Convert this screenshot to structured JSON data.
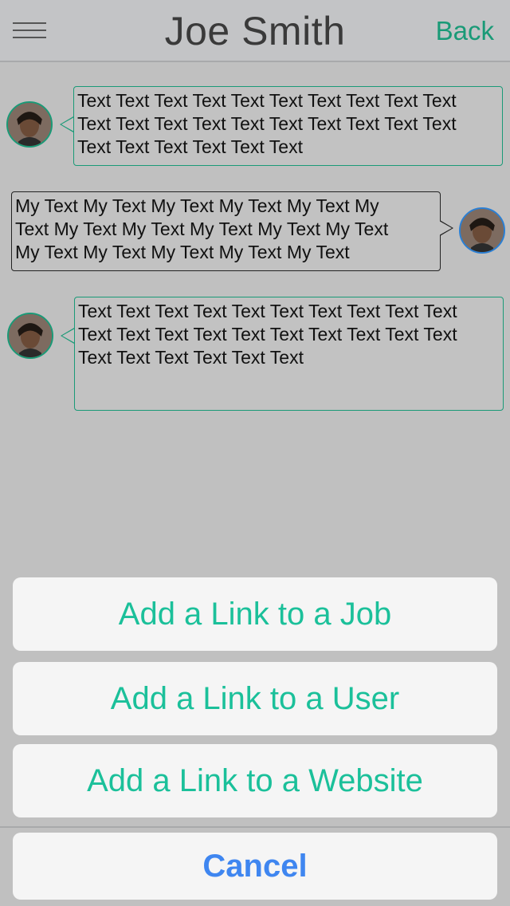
{
  "nav": {
    "title": "Joe Smith",
    "back_label": "Back"
  },
  "messages": [
    {
      "direction": "incoming",
      "lines": [
        "Text Text Text Text Text Text Text Text Text Text",
        "Text Text Text Text Text Text Text Text Text Text",
        "Text Text Text Text Text Text"
      ]
    },
    {
      "direction": "outgoing",
      "lines": [
        "My Text My Text My Text My Text My Text My",
        "Text My Text My Text My Text My Text My Text",
        "My Text My Text My Text My Text My Text"
      ]
    },
    {
      "direction": "incoming",
      "lines": [
        "Text Text Text Text Text Text Text Text Text Text",
        "Text Text Text Text Text Text Text Text Text Text",
        "Text Text Text Text Text Text"
      ]
    }
  ],
  "action_sheet": {
    "options": [
      "Add a Link to a Job",
      "Add a Link to a User",
      "Add a Link to a Website"
    ],
    "cancel_label": "Cancel"
  },
  "colors": {
    "accent": "#1bc09a",
    "back": "#1a9a77",
    "cancel": "#3f86f0",
    "background": "#c0c0c0"
  },
  "icons": {
    "menu": "hamburger-menu-icon",
    "avatar": "user-avatar"
  }
}
